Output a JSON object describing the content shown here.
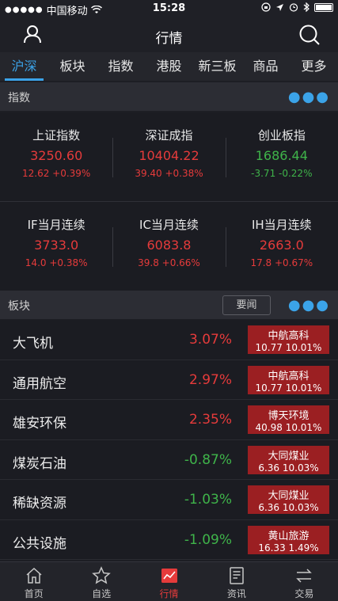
{
  "status_bar": {
    "carrier": "中国移动",
    "time": "15:28"
  },
  "nav": {
    "title": "行情"
  },
  "tabs": [
    {
      "label": "沪深",
      "active": true
    },
    {
      "label": "板块",
      "active": false
    },
    {
      "label": "指数",
      "active": false
    },
    {
      "label": "港股",
      "active": false
    },
    {
      "label": "新三板",
      "active": false
    },
    {
      "label": "商品",
      "active": false
    },
    {
      "label": "更多",
      "active": false
    }
  ],
  "index_section": {
    "label": "指数",
    "indices": [
      {
        "name": "上证指数",
        "price": "3250.60",
        "change": "12.62  +0.39%",
        "direction": "up"
      },
      {
        "name": "深证成指",
        "price": "10404.22",
        "change": "39.40  +0.38%",
        "direction": "up"
      },
      {
        "name": "创业板指",
        "price": "1686.44",
        "change": "-3.71  -0.22%",
        "direction": "down"
      },
      {
        "name": "IF当月连续",
        "price": "3733.0",
        "change": "14.0  +0.38%",
        "direction": "up"
      },
      {
        "name": "IC当月连续",
        "price": "6083.8",
        "change": "39.8  +0.66%",
        "direction": "up"
      },
      {
        "name": "IH当月连续",
        "price": "2663.0",
        "change": "17.8  +0.67%",
        "direction": "up"
      }
    ]
  },
  "sector_section": {
    "label": "板块",
    "news_button": "要闻",
    "sectors": [
      {
        "name": "大飞机",
        "pct": "3.07%",
        "direction": "up",
        "leader": "中航高科",
        "leader_value": "10.77 10.01%"
      },
      {
        "name": "通用航空",
        "pct": "2.97%",
        "direction": "up",
        "leader": "中航高科",
        "leader_value": "10.77 10.01%"
      },
      {
        "name": "雄安环保",
        "pct": "2.35%",
        "direction": "up",
        "leader": "博天环境",
        "leader_value": "40.98 10.01%"
      },
      {
        "name": "煤炭石油",
        "pct": "-0.87%",
        "direction": "down",
        "leader": "大同煤业",
        "leader_value": "6.36 10.03%"
      },
      {
        "name": "稀缺资源",
        "pct": "-1.03%",
        "direction": "down",
        "leader": "大同煤业",
        "leader_value": "6.36 10.03%"
      },
      {
        "name": "公共设施",
        "pct": "-1.09%",
        "direction": "down",
        "leader": "黄山旅游",
        "leader_value": "16.33 1.49%"
      }
    ]
  },
  "bottom_tabs": [
    {
      "label": "首页",
      "icon": "home-icon",
      "active": false
    },
    {
      "label": "自选",
      "icon": "star-icon",
      "active": false
    },
    {
      "label": "行情",
      "icon": "chart-icon",
      "active": true
    },
    {
      "label": "资讯",
      "icon": "news-icon",
      "active": false
    },
    {
      "label": "交易",
      "icon": "trade-icon",
      "active": false
    }
  ],
  "colors": {
    "accent": "#3ba3e8",
    "up": "#e63b3b",
    "down": "#3fb44a",
    "leader_bg": "#9b1f22"
  }
}
